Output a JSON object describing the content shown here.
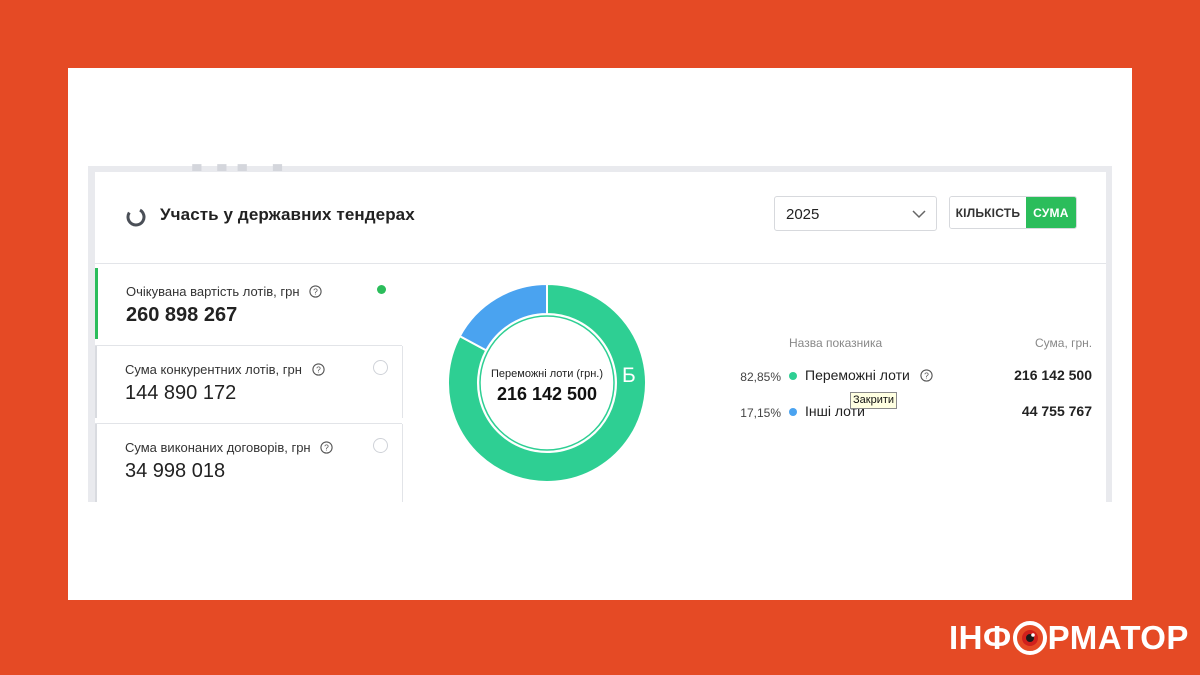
{
  "widget": {
    "title": "Участь у державних тендерах",
    "year_select": {
      "value": "2025"
    },
    "toggle": {
      "count_label": "КІЛЬКІСТЬ",
      "sum_label": "СУМА",
      "active": "sum"
    }
  },
  "metrics": [
    {
      "label": "Очікувана вартість лотів, грн",
      "value": "260 898 267",
      "selected": true
    },
    {
      "label": "Сума конкурентних лотів, грн",
      "value": "144 890 172",
      "selected": false
    },
    {
      "label": "Сума виконаних договорів, грн",
      "value": "34 998 018",
      "selected": false
    }
  ],
  "donut": {
    "center_label": "Переможні лоти (грн.)",
    "center_value": "216 142 500",
    "overlay_letter": "Б"
  },
  "legend": {
    "header_name": "Назва показника",
    "header_sum": "Сума, грн.",
    "rows": [
      {
        "pct": "82,85%",
        "name": "Переможні лоти",
        "value": "216 142 500",
        "color": "#2ecf93",
        "has_help": true
      },
      {
        "pct": "17,15%",
        "name": "Інші лоти",
        "value": "44 755 767",
        "color": "#4aa3f0",
        "has_help": false
      }
    ],
    "tooltip": "Закрити"
  },
  "chart_data": {
    "type": "pie",
    "categories": [
      "Переможні лоти",
      "Інші лоти"
    ],
    "values": [
      216142500,
      44755767
    ],
    "percent": [
      82.85,
      17.15
    ],
    "colors": [
      "#2ecf93",
      "#4aa3f0"
    ]
  },
  "brand": {
    "text_left": "ІНФ",
    "text_right": "РМАТОР"
  },
  "colors": {
    "background": "#e54a25",
    "accent_green": "#2bbd5b"
  },
  "icons": [
    "loader-icon",
    "chevron-down-icon",
    "help-icon",
    "eye-logo-icon"
  ]
}
